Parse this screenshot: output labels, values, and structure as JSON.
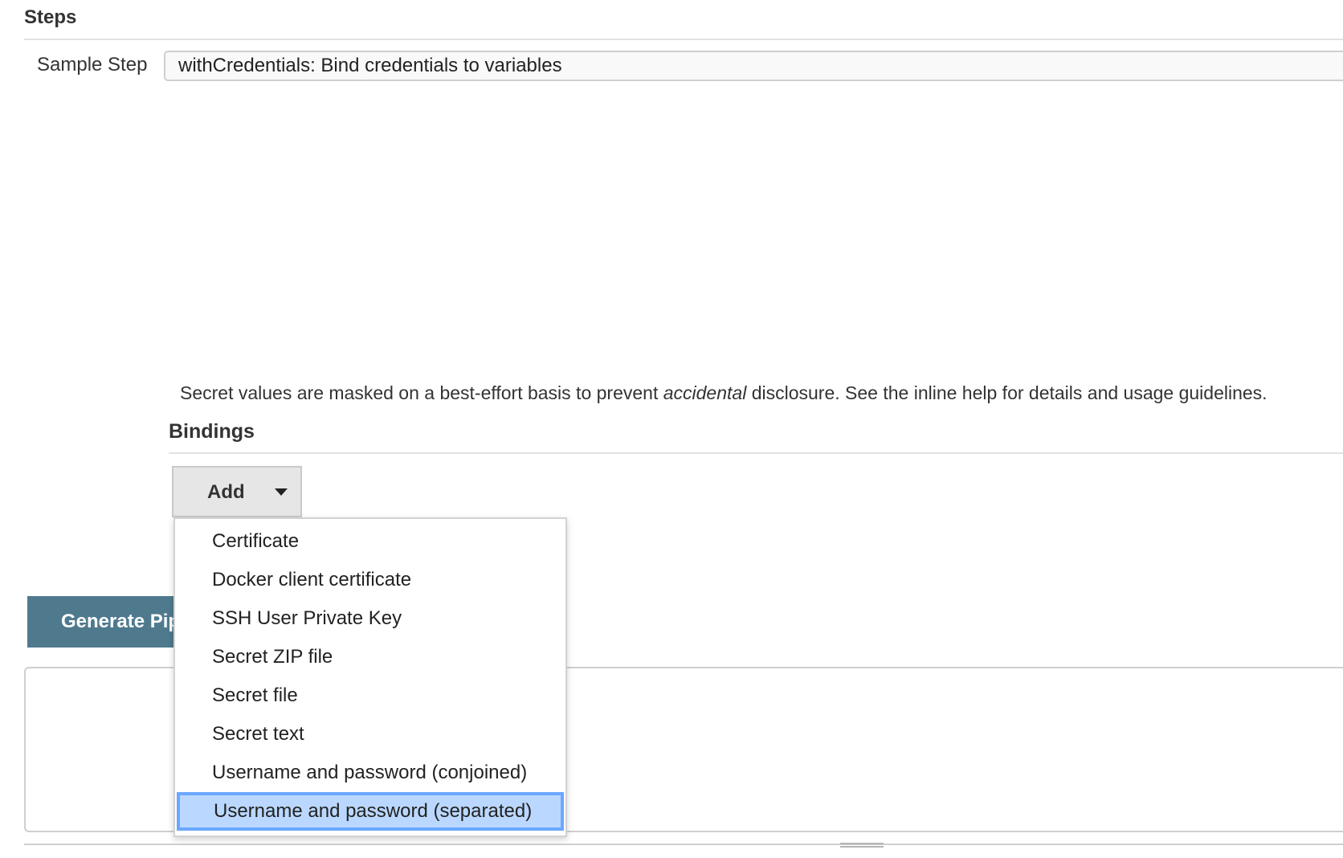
{
  "steps": {
    "title": "Steps",
    "sample_step_label": "Sample Step",
    "sample_step_value": "withCredentials: Bind credentials to variables"
  },
  "secret_note": {
    "before": "Secret values are masked on a best-effort basis to prevent ",
    "emphasis": "accidental",
    "after": " disclosure. See the inline help for details and usage guidelines."
  },
  "bindings": {
    "title": "Bindings",
    "add_label": "Add"
  },
  "dropdown": {
    "items": [
      {
        "label": "Certificate"
      },
      {
        "label": "Docker client certificate"
      },
      {
        "label": "SSH User Private Key"
      },
      {
        "label": "Secret ZIP file"
      },
      {
        "label": "Secret file"
      },
      {
        "label": "Secret text"
      },
      {
        "label": "Username and password (conjoined)"
      },
      {
        "label": "Username and password (separated)"
      }
    ],
    "selected_index": 7,
    "highlight_color": "#bad8ff",
    "highlight_border_color": "#6aa7ff"
  },
  "generate": {
    "label": "Generate Pipeline Script",
    "color": "#4f7a8e"
  },
  "output": {
    "value": ""
  }
}
